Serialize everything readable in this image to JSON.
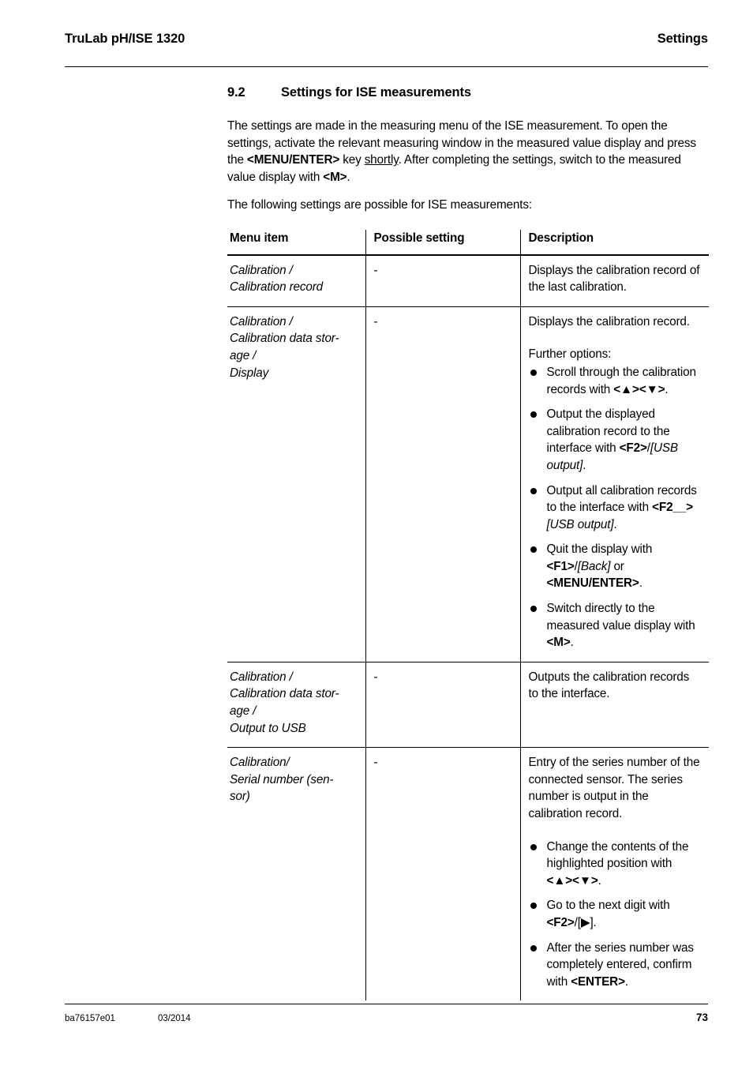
{
  "header": {
    "left": "TruLab pH/ISE 1320",
    "right": "Settings"
  },
  "section": {
    "number": "9.2",
    "title": "Settings for ISE measurements"
  },
  "intro": {
    "p1_part1": "The settings are made in the measuring menu of the ISE measurement. To open the settings, activate the relevant measuring window in the measured value display and press the ",
    "p1_key1": "<MENU/ENTER>",
    "p1_part2": " key ",
    "p1_underlined": "shortly",
    "p1_part3": ". After completing the settings, switch to the measured value display with ",
    "p1_key2": "<M>",
    "p1_part4": ".",
    "p2": "The following settings are possible for ISE measurements:"
  },
  "table": {
    "headers": {
      "menu_item": "Menu item",
      "possible_setting": "Possible setting",
      "description": "Description"
    },
    "rows": [
      {
        "menu_item_lines": [
          "Calibration /",
          "Calibration record"
        ],
        "possible_setting": "-",
        "description": "Displays the calibration record of the last calibration."
      },
      {
        "menu_item_lines": [
          "Calibration /",
          "Calibration data stor-",
          "age /",
          "Display"
        ],
        "possible_setting": "-",
        "desc_intro": "Displays the calibration record.",
        "desc_further": "Further options:",
        "bullets": [
          {
            "t1": "Scroll through the calibration records with ",
            "k1": "<▲><▼>",
            "t2": "."
          },
          {
            "t1": "Output the displayed calibration record to the interface with ",
            "k1": "<F2>",
            "t2": "/",
            "i1": "[USB output]",
            "t3": "."
          },
          {
            "t1": "Output all calibration records to the interface with ",
            "k1": "<F2__>",
            "i1": "[USB output]",
            "t3": "."
          },
          {
            "t1": "Quit the display with ",
            "k1": "<F1>",
            "t2": "/",
            "i1": "[Back]",
            "t3": " or ",
            "k2": "<MENU/ENTER>",
            "t4": "."
          },
          {
            "t1": "Switch directly to the measured value display with ",
            "k1": "<M>",
            "t2": "."
          }
        ]
      },
      {
        "menu_item_lines": [
          "Calibration /",
          "Calibration data stor-",
          "age /",
          "Output to USB"
        ],
        "possible_setting": "-",
        "description": "Outputs the calibration records to the interface."
      },
      {
        "menu_item_lines": [
          "Calibration/",
          "Serial number (sen-",
          "sor)"
        ],
        "possible_setting": "-",
        "desc_intro": "Entry of the series number of the connected sensor. The series number is output in the calibration record.",
        "bullets": [
          {
            "t1": "Change the contents of the highlighted position with ",
            "k1": "<▲><▼>",
            "t2": "."
          },
          {
            "t1": "Go to the next digit with ",
            "k1": "<F2>",
            "t2": "/[▶]."
          },
          {
            "t1": "After the series number was completely entered, confirm with ",
            "k1": "<ENTER>",
            "t2": "."
          }
        ]
      }
    ]
  },
  "footer": {
    "doc_number": "ba76157e01",
    "date": "03/2014",
    "page_number": "73"
  }
}
